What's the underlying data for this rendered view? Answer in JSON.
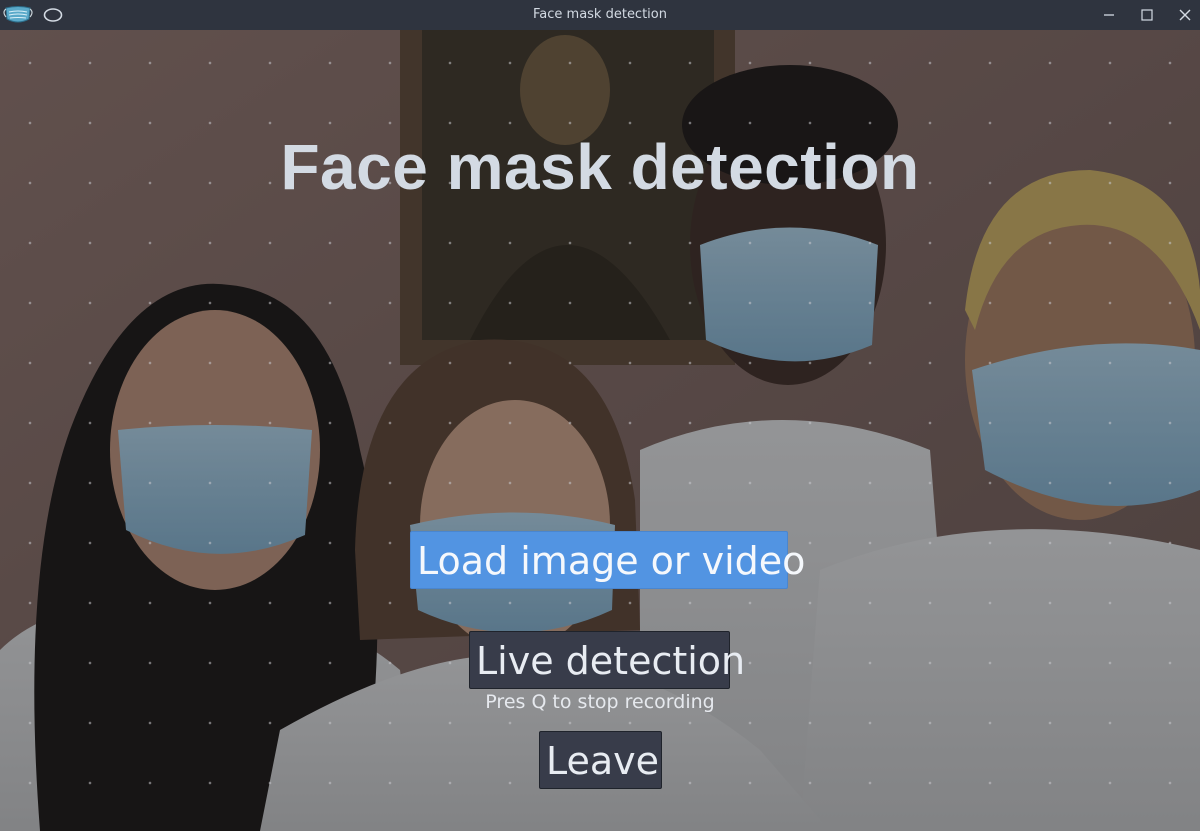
{
  "window": {
    "title": "Face mask detection"
  },
  "main": {
    "heading": "Face mask detection",
    "buttons": {
      "load": "Load image or video",
      "live": "Live detection",
      "leave": "Leave"
    },
    "hint": "Pres Q to stop recording"
  },
  "icons": {
    "app": "face-mask-icon",
    "pin": "ellipse-pin-icon",
    "minimize": "minimize-icon",
    "maximize": "maximize-icon",
    "close": "close-icon"
  },
  "colors": {
    "titlebar_bg": "#2f343f",
    "title_text": "#d3dae3",
    "primary_button": "#5294e2",
    "secondary_button": "#383c4a",
    "heading_text": "#d3dae3"
  }
}
